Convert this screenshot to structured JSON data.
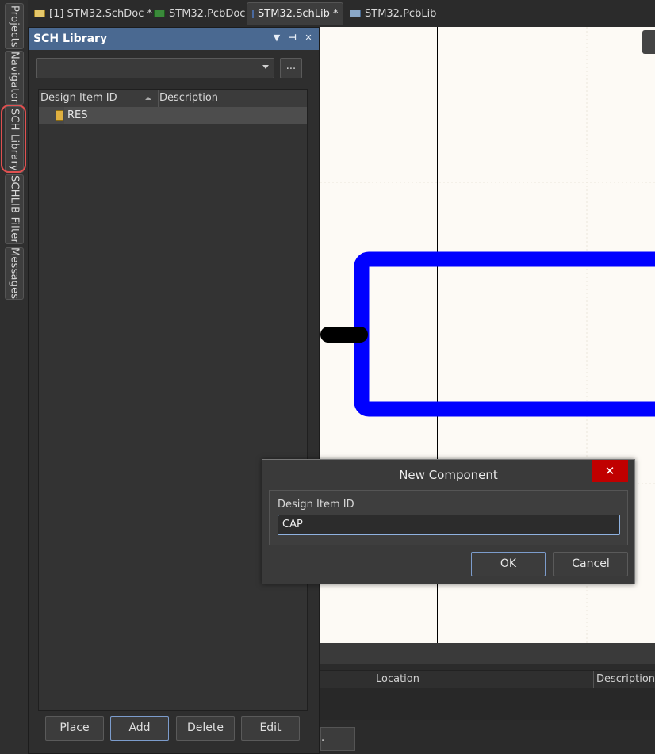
{
  "left_tabs": [
    "Projects",
    "Navigator",
    "SCH Library",
    "SCHLIB Filter",
    "Messages"
  ],
  "doc_tabs": [
    {
      "label": "[1] STM32.SchDoc *",
      "icon": "schdoc-icon"
    },
    {
      "label": "STM32.PcbDoc",
      "icon": "pcbdoc-icon"
    },
    {
      "label": "STM32.SchLib *",
      "icon": "schlib-icon",
      "active": true
    },
    {
      "label": "STM32.PcbLib",
      "icon": "pcblib-icon"
    }
  ],
  "panel": {
    "title": "SCH Library",
    "browse_label": "...",
    "columns": {
      "id": "Design Item ID",
      "description": "Description"
    },
    "items": [
      {
        "id": "RES",
        "description": ""
      }
    ],
    "buttons": {
      "place": "Place",
      "add": "Add",
      "delete": "Delete",
      "edit": "Edit"
    }
  },
  "bottom": {
    "columns": {
      "location": "Location",
      "description": "Description"
    },
    "button_label": "."
  },
  "dialog": {
    "title": "New Component",
    "close_label": "✕",
    "field_label": "Design Item ID",
    "field_value": "CAP",
    "ok_label": "OK",
    "cancel_label": "Cancel"
  },
  "colors": {
    "panel_title": "#4a6991",
    "component_outline": "#0000ff",
    "pin": "#000000",
    "close_button": "#c00000",
    "highlight_mark": "#e05050"
  }
}
